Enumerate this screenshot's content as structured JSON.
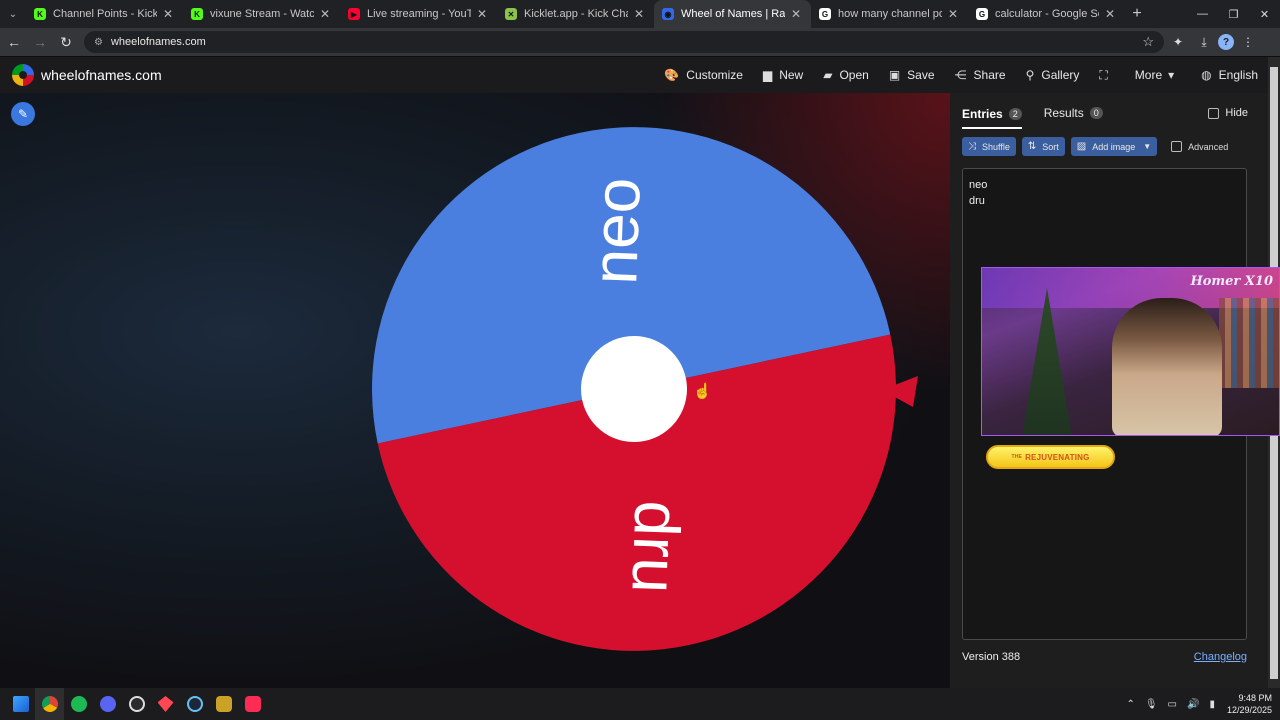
{
  "browser": {
    "tabs": [
      {
        "title": "Channel Points - Kick Dashboard",
        "favicon_color": "#53fc18",
        "favicon_glyph": "K"
      },
      {
        "title": "vixune Stream - Watch Live on Kick",
        "favicon_color": "#53fc18",
        "favicon_glyph": "K"
      },
      {
        "title": "Live streaming - YouTube Studio",
        "favicon_color": "#ff0033",
        "favicon_glyph": "▶"
      },
      {
        "title": "Kicklet.app - Kick Chatbot and Overlays",
        "favicon_color": "#8bc34a",
        "favicon_glyph": "✕"
      },
      {
        "title": "Wheel of Names | Random name picker",
        "favicon_color": "#3369e8",
        "favicon_glyph": "◉",
        "active": true
      },
      {
        "title": "how many channel points per hour on kick",
        "favicon_color": "#ffffff",
        "favicon_glyph": "G"
      },
      {
        "title": "calculator - Google Search",
        "favicon_color": "#ffffff",
        "favicon_glyph": "G"
      }
    ],
    "url": "wheelofnames.com"
  },
  "header": {
    "brand": "wheelofnames.com",
    "nav": [
      {
        "label": "Customize",
        "icon": "palette-icon",
        "glyph": "🎨"
      },
      {
        "label": "New",
        "icon": "file-icon",
        "glyph": "▆"
      },
      {
        "label": "Open",
        "icon": "folder-icon",
        "glyph": "▰"
      },
      {
        "label": "Save",
        "icon": "save-icon",
        "glyph": "▣"
      },
      {
        "label": "Share",
        "icon": "share-icon",
        "glyph": "⋲"
      },
      {
        "label": "Gallery",
        "icon": "search-icon",
        "glyph": "⚲"
      },
      {
        "label": "",
        "icon": "fullscreen-icon",
        "glyph": "⛶"
      },
      {
        "label": "More",
        "icon": "caret-down-icon",
        "glyph": "▾"
      },
      {
        "label": "English",
        "icon": "globe-icon",
        "glyph": "◍"
      }
    ]
  },
  "wheel": {
    "segments": [
      {
        "label": "neo",
        "color": "#4a7fe0"
      },
      {
        "label": "dru",
        "color": "#d4102e"
      }
    ],
    "pointer_color": "#d4102e"
  },
  "sidebar": {
    "tabs": [
      {
        "label": "Entries",
        "count": "2",
        "active": true
      },
      {
        "label": "Results",
        "count": "0",
        "active": false
      }
    ],
    "hide_label": "Hide",
    "actions": [
      {
        "label": "Shuffle",
        "icon": "shuffle-icon",
        "glyph": "⤨"
      },
      {
        "label": "Sort",
        "icon": "sort-icon",
        "glyph": "⇅"
      },
      {
        "label": "Add image",
        "icon": "image-icon",
        "glyph": "▨"
      }
    ],
    "advanced_label": "Advanced",
    "entries": [
      "neo",
      "dru"
    ],
    "version": "Version 388",
    "changelog": "Changelog"
  },
  "overlay": {
    "webcam_logo": "Homer X10",
    "banner_small": "THE",
    "banner": "REJUVENATING"
  },
  "taskbar": {
    "time": "9:48 PM",
    "date": "12/29/2025"
  }
}
